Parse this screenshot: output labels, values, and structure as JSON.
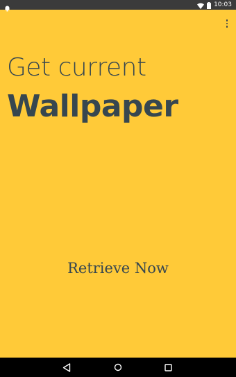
{
  "status_bar": {
    "time": "10:03",
    "icons": [
      "android-icon",
      "wifi-icon",
      "battery-icon"
    ]
  },
  "header": {
    "line1": "Get current",
    "line2": "Wallpaper"
  },
  "actions": {
    "retrieve_label": "Retrieve Now"
  },
  "navigation": {
    "buttons": [
      "back-icon",
      "home-icon",
      "recents-icon"
    ]
  },
  "colors": {
    "background": "#FFCA38",
    "text": "#37474F",
    "status_bar": "#3b3b3b",
    "nav_bar": "#000000"
  }
}
